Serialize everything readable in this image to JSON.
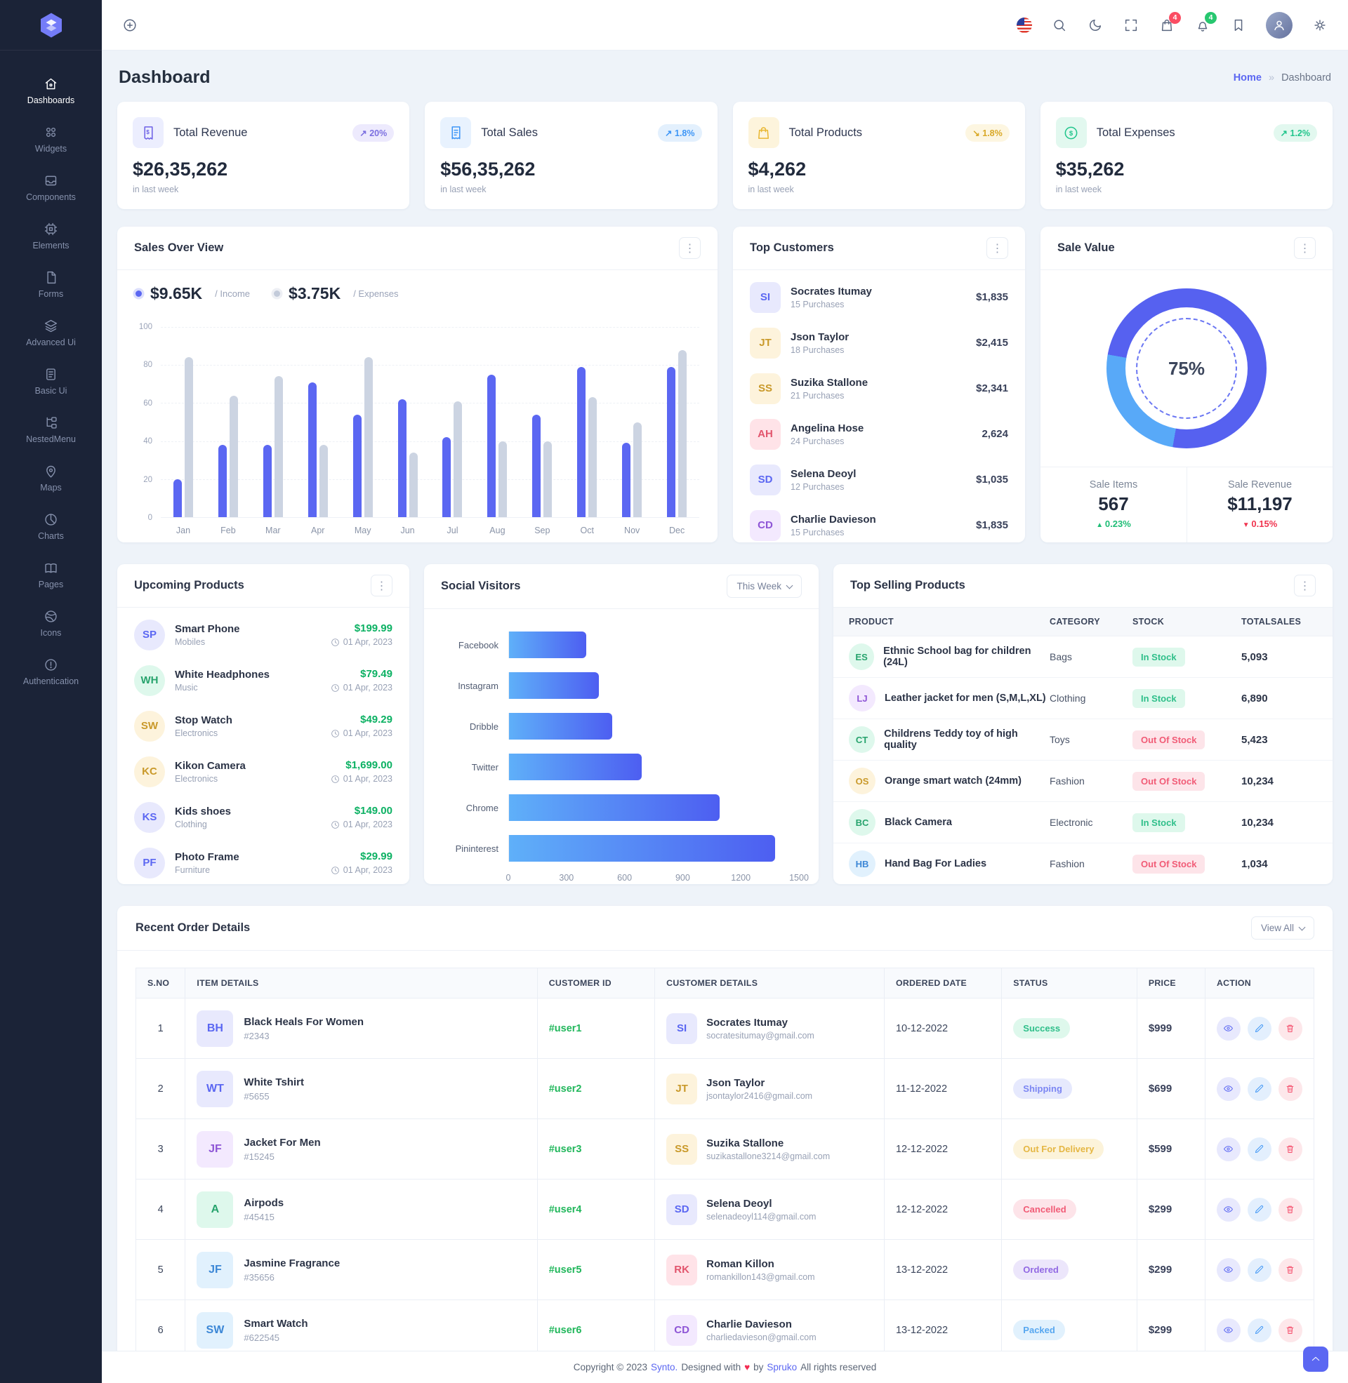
{
  "navbar": {
    "cart_badge": "4",
    "bell_badge": "4"
  },
  "sidebar": {
    "items": [
      {
        "label": "Dashboards",
        "icon": "home-icon",
        "active": true
      },
      {
        "label": "Widgets",
        "icon": "widgets-icon"
      },
      {
        "label": "Components",
        "icon": "components-icon"
      },
      {
        "label": "Elements",
        "icon": "elements-icon"
      },
      {
        "label": "Forms",
        "icon": "forms-icon"
      },
      {
        "label": "Advanced Ui",
        "icon": "layers-icon"
      },
      {
        "label": "Basic Ui",
        "icon": "document-icon"
      },
      {
        "label": "NestedMenu",
        "icon": "tree-icon"
      },
      {
        "label": "Maps",
        "icon": "map-pin-icon"
      },
      {
        "label": "Charts",
        "icon": "pie-chart-icon"
      },
      {
        "label": "Pages",
        "icon": "book-icon"
      },
      {
        "label": "Icons",
        "icon": "dribbble-icon"
      },
      {
        "label": "Authentication",
        "icon": "alert-circle-icon"
      }
    ]
  },
  "page": {
    "title": "Dashboard",
    "breadcrumb_home": "Home",
    "breadcrumb_current": "Dashboard"
  },
  "stats": [
    {
      "title": "Total Revenue",
      "value": "$26,35,262",
      "change": "20%",
      "direction": "up",
      "period": "in last week"
    },
    {
      "title": "Total Sales",
      "value": "$56,35,262",
      "change": "1.8%",
      "direction": "up",
      "period": "in last week"
    },
    {
      "title": "Total Products",
      "value": "$4,262",
      "change": "1.8%",
      "direction": "down",
      "period": "in last week"
    },
    {
      "title": "Total Expenses",
      "value": "$35,262",
      "change": "1.2%",
      "direction": "up",
      "period": "in last week"
    }
  ],
  "sales_overview": {
    "title": "Sales Over View",
    "income_value": "$9.65K",
    "income_label": "/ Income",
    "expenses_value": "$3.75K",
    "expenses_label": "/ Expenses",
    "chart_data": {
      "type": "bar",
      "categories": [
        "Jan",
        "Feb",
        "Mar",
        "Apr",
        "May",
        "Jun",
        "Jul",
        "Aug",
        "Sep",
        "Oct",
        "Nov",
        "Dec"
      ],
      "series": [
        {
          "name": "Income",
          "values": [
            20,
            38,
            38,
            71,
            54,
            62,
            42,
            75,
            54,
            79,
            39,
            79
          ]
        },
        {
          "name": "Expenses",
          "values": [
            84,
            64,
            74,
            38,
            84,
            34,
            61,
            40,
            40,
            63,
            50,
            88
          ]
        }
      ],
      "ylim": [
        0,
        100
      ],
      "yticks": [
        100,
        80,
        60,
        40,
        20,
        0
      ]
    }
  },
  "top_customers": {
    "title": "Top Customers",
    "items": [
      {
        "name": "Socrates Itumay",
        "purchases": "15 Purchases",
        "amount": "$1,835"
      },
      {
        "name": "Json Taylor",
        "purchases": "18 Purchases",
        "amount": "$2,415"
      },
      {
        "name": "Suzika Stallone",
        "purchases": "21 Purchases",
        "amount": "$2,341"
      },
      {
        "name": "Angelina Hose",
        "purchases": "24 Purchases",
        "amount": "2,624"
      },
      {
        "name": "Selena Deoyl",
        "purchases": "12 Purchases",
        "amount": "$1,035"
      },
      {
        "name": "Charlie Davieson",
        "purchases": "15 Purchases",
        "amount": "$1,835"
      }
    ]
  },
  "sale_value": {
    "title": "Sale Value",
    "percent": 75,
    "center_label": "75%",
    "stats": [
      {
        "label": "Sale Items",
        "value": "567",
        "change": "0.23%",
        "direction": "up"
      },
      {
        "label": "Sale Revenue",
        "value": "$11,197",
        "change": "0.15%",
        "direction": "down"
      }
    ]
  },
  "upcoming_products": {
    "title": "Upcoming Products",
    "items": [
      {
        "name": "Smart Phone",
        "category": "Mobiles",
        "price": "$199.99",
        "date": "01 Apr, 2023"
      },
      {
        "name": "White Headphones",
        "category": "Music",
        "price": "$79.49",
        "date": "01 Apr, 2023"
      },
      {
        "name": "Stop Watch",
        "category": "Electronics",
        "price": "$49.29",
        "date": "01 Apr, 2023"
      },
      {
        "name": "Kikon Camera",
        "category": "Electronics",
        "price": "$1,699.00",
        "date": "01 Apr, 2023"
      },
      {
        "name": "Kids shoes",
        "category": "Clothing",
        "price": "$149.00",
        "date": "01 Apr, 2023"
      },
      {
        "name": "Photo Frame",
        "category": "Furniture",
        "price": "$29.99",
        "date": "01 Apr, 2023"
      }
    ]
  },
  "social_visitors": {
    "title": "Social Visitors",
    "filter": "This Week",
    "chart_data": {
      "type": "bar-horizontal",
      "categories": [
        "Facebook",
        "Instagram",
        "Dribble",
        "Twitter",
        "Chrome",
        "Pininterest"
      ],
      "values": [
        400,
        465,
        535,
        685,
        1090,
        1375
      ],
      "xlim": [
        0,
        1500
      ],
      "xticks": [
        0,
        300,
        600,
        900,
        1200,
        1500
      ]
    }
  },
  "top_selling": {
    "title": "Top Selling Products",
    "columns": [
      "PRODUCT",
      "CATEGORY",
      "STOCK",
      "TOTALSALES"
    ],
    "rows": [
      {
        "product": "Ethnic School bag for children (24L)",
        "category": "Bags",
        "stock": "In Stock",
        "sales": "5,093"
      },
      {
        "product": "Leather jacket for men (S,M,L,XL)",
        "category": "Clothing",
        "stock": "In Stock",
        "sales": "6,890"
      },
      {
        "product": "Childrens Teddy toy of high quality",
        "category": "Toys",
        "stock": "Out Of Stock",
        "sales": "5,423"
      },
      {
        "product": "Orange smart watch (24mm)",
        "category": "Fashion",
        "stock": "Out Of Stock",
        "sales": "10,234"
      },
      {
        "product": "Black Camera",
        "category": "Electronic",
        "stock": "In Stock",
        "sales": "10,234"
      },
      {
        "product": "Hand Bag For Ladies",
        "category": "Fashion",
        "stock": "Out Of Stock",
        "sales": "1,034"
      }
    ]
  },
  "recent_orders": {
    "title": "Recent Order Details",
    "view_all": "View All",
    "columns": [
      "S.NO",
      "ITEM DETAILS",
      "CUSTOMER ID",
      "CUSTOMER DETAILS",
      "ORDERED DATE",
      "STATUS",
      "PRICE",
      "ACTION"
    ],
    "rows": [
      {
        "sno": "1",
        "item": "Black Heals For Women",
        "item_id": "#2343",
        "customer_id": "#user1",
        "customer": "Socrates Itumay",
        "email": "socratesitumay@gmail.com",
        "date": "10-12-2022",
        "status": "Success",
        "price": "$999"
      },
      {
        "sno": "2",
        "item": "White Tshirt",
        "item_id": "#5655",
        "customer_id": "#user2",
        "customer": "Json Taylor",
        "email": "jsontaylor2416@gmail.com",
        "date": "11-12-2022",
        "status": "Shipping",
        "price": "$699"
      },
      {
        "sno": "3",
        "item": "Jacket For Men",
        "item_id": "#15245",
        "customer_id": "#user3",
        "customer": "Suzika Stallone",
        "email": "suzikastallone3214@gmail.com",
        "date": "12-12-2022",
        "status": "Out For Delivery",
        "price": "$599"
      },
      {
        "sno": "4",
        "item": "Airpods",
        "item_id": "#45415",
        "customer_id": "#user4",
        "customer": "Selena Deoyl",
        "email": "selenadeoyl114@gmail.com",
        "date": "12-12-2022",
        "status": "Cancelled",
        "price": "$299"
      },
      {
        "sno": "5",
        "item": "Jasmine Fragrance",
        "item_id": "#35656",
        "customer_id": "#user5",
        "customer": "Roman Killon",
        "email": "romankillon143@gmail.com",
        "date": "13-12-2022",
        "status": "Ordered",
        "price": "$299"
      },
      {
        "sno": "6",
        "item": "Smart Watch",
        "item_id": "#622545",
        "customer_id": "#user6",
        "customer": "Charlie Davieson",
        "email": "charliedavieson@gmail.com",
        "date": "13-12-2022",
        "status": "Packed",
        "price": "$299"
      }
    ]
  },
  "footer": {
    "copyright": "Copyright © 2023",
    "brand": "Synto.",
    "designed": "Designed with",
    "heart": "♥",
    "by": "by",
    "brand2": "Spruko",
    "rights": "All rights reserved"
  },
  "colors": {
    "primary": "#5b67f2",
    "income_bar": "#5b67f2",
    "expense_bar": "#ccd4e2",
    "donut_primary": "#5661f0",
    "donut_secondary": "#58a9f8",
    "success": "#2fbf8a",
    "danger": "#f15b76",
    "warning": "#e5b744",
    "info": "#57a7f0",
    "price_green": "#0cb163"
  }
}
